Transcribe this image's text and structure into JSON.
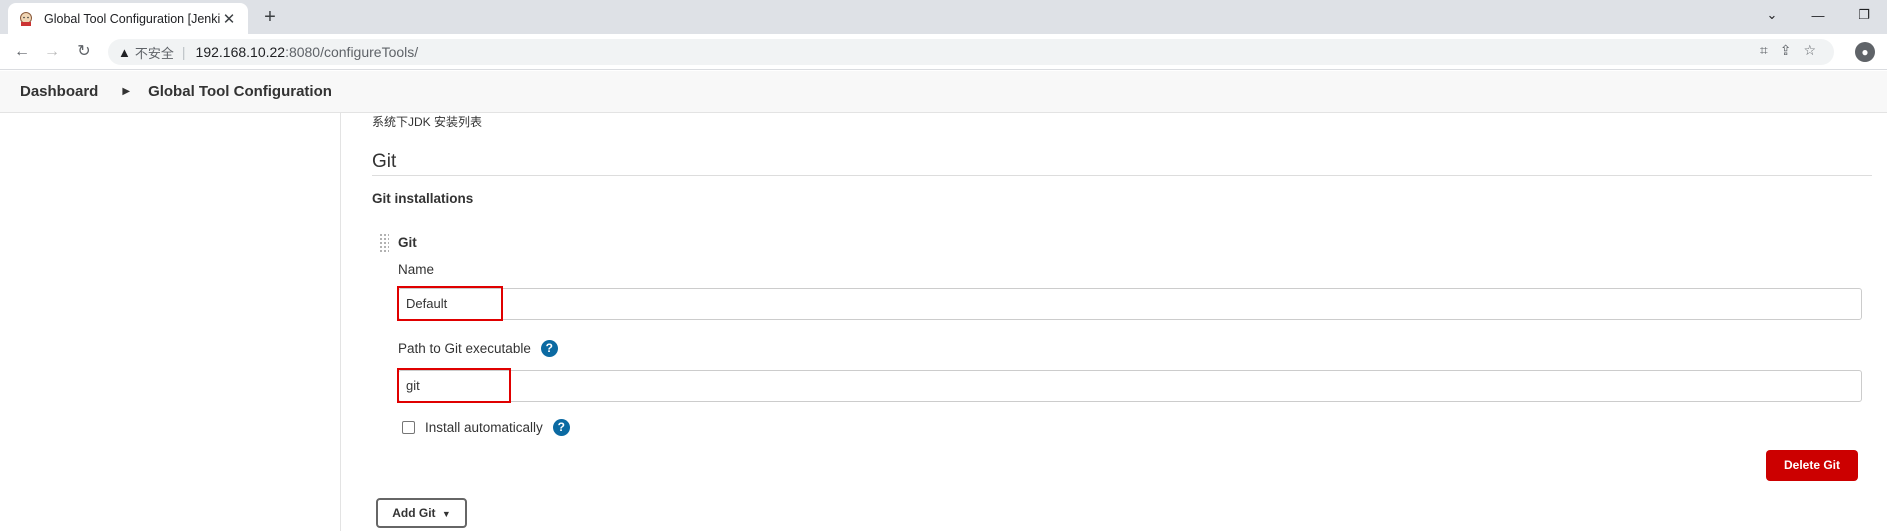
{
  "browser": {
    "tab_title": "Global Tool Configuration [Jenkins]",
    "insecure_label": "不安全",
    "url_host": "192.168.10.22",
    "url_rest": ":8080/configureTools/"
  },
  "breadcrumb": {
    "items": [
      "Dashboard",
      "Global Tool Configuration"
    ]
  },
  "jdk": {
    "description": "系统下JDK 安装列表"
  },
  "git_section": {
    "title": "Git",
    "installations_label": "Git installations",
    "item_title": "Git",
    "name_label": "Name",
    "name_value": "Default",
    "path_label": "Path to Git executable",
    "path_value": "git",
    "install_auto_label": "Install automatically",
    "delete_label": "Delete Git",
    "add_label": "Add Git"
  },
  "colors": {
    "delete_button": "#cc0000",
    "help_icon": "#0b6aa2",
    "highlight": "#e00000"
  }
}
